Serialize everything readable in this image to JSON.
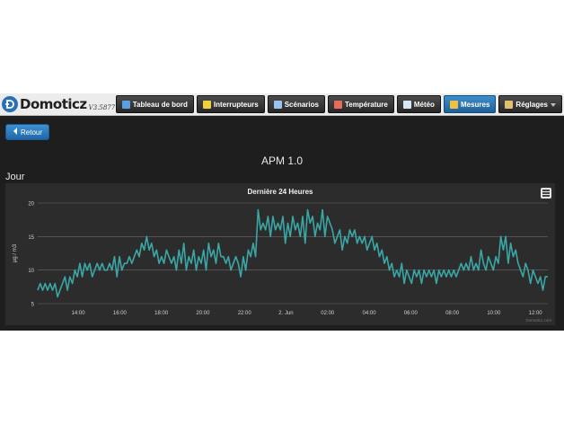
{
  "app": {
    "name": "Domoticz",
    "version": "V3.5877",
    "brand_color": "#2a6fb8"
  },
  "nav": {
    "items": [
      {
        "label": "Tableau de bord",
        "icon": "dashboard-icon",
        "active": false
      },
      {
        "label": "Interrupteurs",
        "icon": "lightbulb-icon",
        "active": false
      },
      {
        "label": "Scénarios",
        "icon": "scenes-icon",
        "active": false
      },
      {
        "label": "Température",
        "icon": "thermometer-icon",
        "active": false
      },
      {
        "label": "Météo",
        "icon": "weather-icon",
        "active": false
      },
      {
        "label": "Mesures",
        "icon": "utility-icon",
        "active": true
      },
      {
        "label": "Réglages",
        "icon": "tools-icon",
        "active": false,
        "dropdown": true
      }
    ]
  },
  "back_button": {
    "label": "Retour"
  },
  "page_title": "APM 1.0",
  "section_label": "Jour",
  "chart": {
    "credit": "Domoticz.com",
    "colors": {
      "line": "#3aa6a6",
      "grid": "#6a6a6a",
      "axis_text": "#cfcfcf"
    }
  },
  "chart_data": {
    "type": "line",
    "title": "Dernière 24 Heures",
    "ylabel": "µg / m3",
    "xlabel": "",
    "ylim": [
      5,
      20
    ],
    "yticks": [
      5,
      10,
      15,
      20
    ],
    "xlim": [
      13.0,
      24.6
    ],
    "xticks": [
      {
        "x": 14,
        "label": "14:00"
      },
      {
        "x": 16,
        "label": "16:00"
      },
      {
        "x": 18,
        "label": "18:00"
      },
      {
        "x": 20,
        "label": "20:00"
      },
      {
        "x": 22,
        "label": "22:00"
      },
      {
        "x": 24,
        "label": "2. Jun"
      },
      {
        "x": 26,
        "label": "02:00"
      },
      {
        "x": 28,
        "label": "04:00"
      },
      {
        "x": 30,
        "label": "06:00"
      },
      {
        "x": 32,
        "label": "08:00"
      },
      {
        "x": 34,
        "label": "10:00"
      },
      {
        "x": 36,
        "label": "12:00"
      }
    ],
    "grid": true,
    "series": [
      {
        "name": "",
        "x_hours_start": 12.05,
        "x_hours_end": 36.6,
        "values": [
          7,
          8,
          7,
          8,
          7,
          8,
          7,
          8,
          6,
          7,
          8,
          9,
          7,
          9,
          8,
          10,
          9,
          11,
          9,
          11,
          10,
          11,
          9,
          10,
          11,
          10,
          11,
          10,
          10,
          11,
          10,
          12,
          9,
          12,
          10,
          11,
          11,
          12,
          11,
          12,
          13,
          12,
          14,
          13,
          15,
          13,
          14,
          12,
          13,
          11,
          12,
          11,
          13,
          12,
          11,
          12,
          10,
          13,
          11,
          14,
          10,
          12,
          11,
          13,
          10,
          12,
          11,
          13,
          10,
          14,
          12,
          13,
          11,
          14,
          12,
          12,
          11,
          12,
          10,
          11,
          12,
          11,
          9,
          12,
          10,
          13,
          12,
          14,
          12,
          19,
          16,
          17,
          16,
          18,
          15,
          18,
          16,
          17,
          16,
          18,
          14,
          17,
          15,
          18,
          16,
          17,
          15,
          18,
          14,
          19,
          17,
          18,
          15,
          17,
          16,
          19,
          15,
          18,
          17,
          16,
          14,
          15,
          16,
          13,
          15,
          14,
          16,
          15,
          16,
          14,
          15,
          14,
          15,
          13,
          14,
          15,
          13,
          14,
          12,
          13,
          11,
          12,
          10,
          11,
          9,
          10,
          9,
          11,
          8,
          10,
          9,
          8,
          10,
          9,
          10,
          8,
          10,
          9,
          10,
          9,
          10,
          8,
          10,
          9,
          10,
          9,
          10,
          9,
          10,
          9,
          10,
          11,
          10,
          11,
          10,
          12,
          10,
          11,
          10,
          13,
          11,
          10,
          12,
          11,
          10,
          12,
          11,
          15,
          13,
          15,
          11,
          14,
          12,
          13,
          11,
          10,
          9,
          11,
          10,
          8,
          10,
          9,
          8,
          9,
          7,
          9,
          9
        ]
      }
    ]
  }
}
